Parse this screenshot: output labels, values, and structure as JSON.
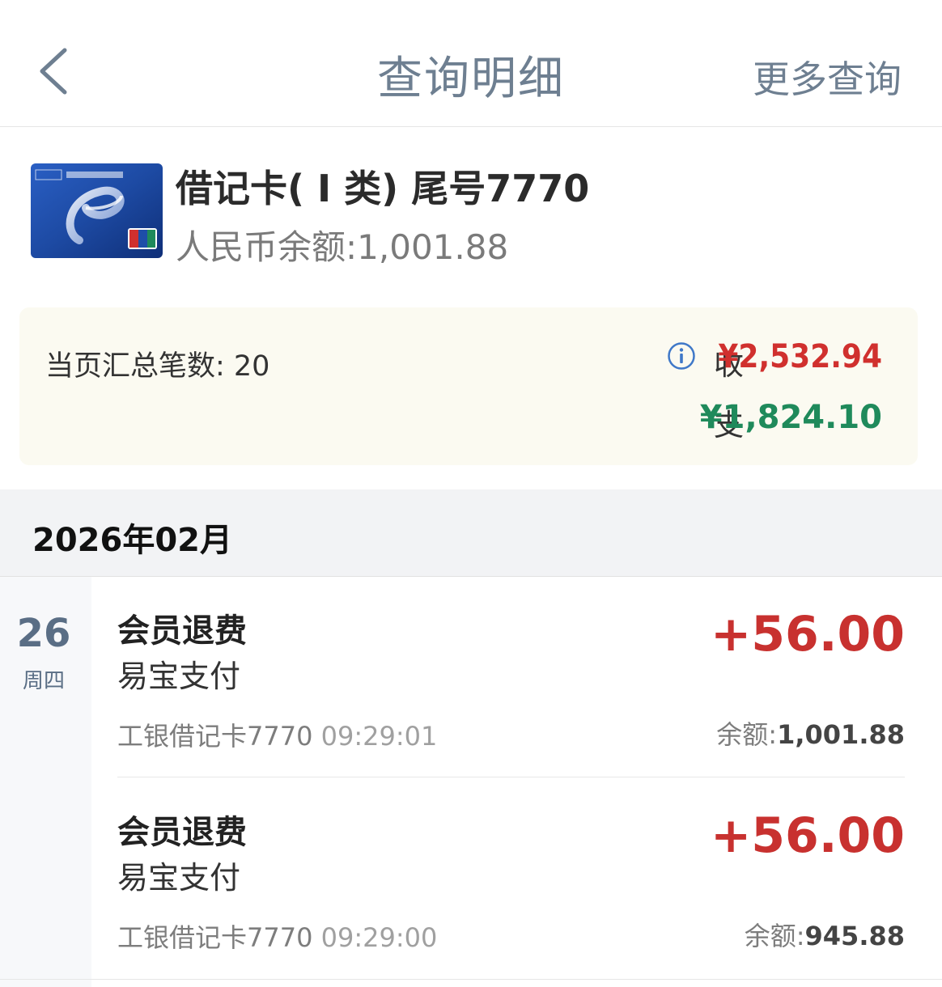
{
  "header": {
    "title": "查询明细",
    "more_label": "更多查询"
  },
  "card": {
    "name": "借记卡( Ⅰ 类) 尾号7770",
    "balance": "人民币余额:1,001.88",
    "brand_colors": {
      "primary": "#1e4ea8",
      "accent": "#d0302e"
    }
  },
  "summary": {
    "count_text": "当页汇总笔数: 20",
    "income_label": "收",
    "income_value": "¥2,532.94",
    "expense_label": "支",
    "expense_value": "¥1,824.10",
    "icon": "info-icon"
  },
  "month": "2026年02月",
  "date": {
    "day": "26",
    "weekday": "周四"
  },
  "transactions": [
    {
      "title": "会员退费",
      "merchant": "易宝支付",
      "amount": "+56.00",
      "account": "工银借记卡7770",
      "time": "09:29:01",
      "balance_label": "余额:",
      "balance_value": "1,001.88"
    },
    {
      "title": "会员退费",
      "merchant": "易宝支付",
      "amount": "+56.00",
      "account": "工银借记卡7770",
      "time": "09:29:00",
      "balance_label": "余额:",
      "balance_value": "945.88"
    }
  ],
  "colors": {
    "income": "#d0302e",
    "expense": "#1f8a5b",
    "header_text": "#6e7f91"
  }
}
